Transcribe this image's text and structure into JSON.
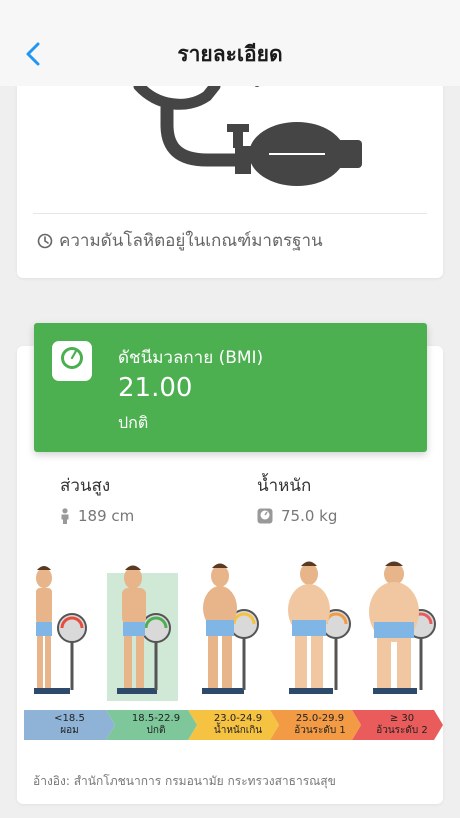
{
  "header": {
    "title": "รายละเอียด"
  },
  "blood_pressure": {
    "status_text": "ความดันโลหิตอยู่ในเกณฑ์มาตรฐาน"
  },
  "bmi": {
    "title": "ดัชนีมวลกาย (BMI)",
    "value": "21.00",
    "status": "ปกติ"
  },
  "height": {
    "label": "ส่วนสูง",
    "value": "189 cm"
  },
  "weight": {
    "label": "น้ำหนัก",
    "value": "75.0 kg"
  },
  "scale": [
    {
      "range": "<18.5",
      "label": "ผอม",
      "color": "#8fb3d6"
    },
    {
      "range": "18.5-22.9",
      "label": "ปกติ",
      "color": "#7dc79a"
    },
    {
      "range": "23.0-24.9",
      "label": "น้ำหนักเกิน",
      "color": "#f5c242"
    },
    {
      "range": "25.0-29.9",
      "label": "อ้วนระดับ 1",
      "color": "#f39a45"
    },
    {
      "range": "≥ 30",
      "label": "อ้วนระดับ 2",
      "color": "#ea5b5b"
    }
  ],
  "selected_category": 1,
  "reference": "อ้างอิง: สำนักโภชนาการ กรมอนามัย กระทรวงสาธารณสุข",
  "colors": {
    "accent_blue": "#2196f3",
    "banner_green": "#4caf50",
    "highlight": "#cfe9d6"
  }
}
